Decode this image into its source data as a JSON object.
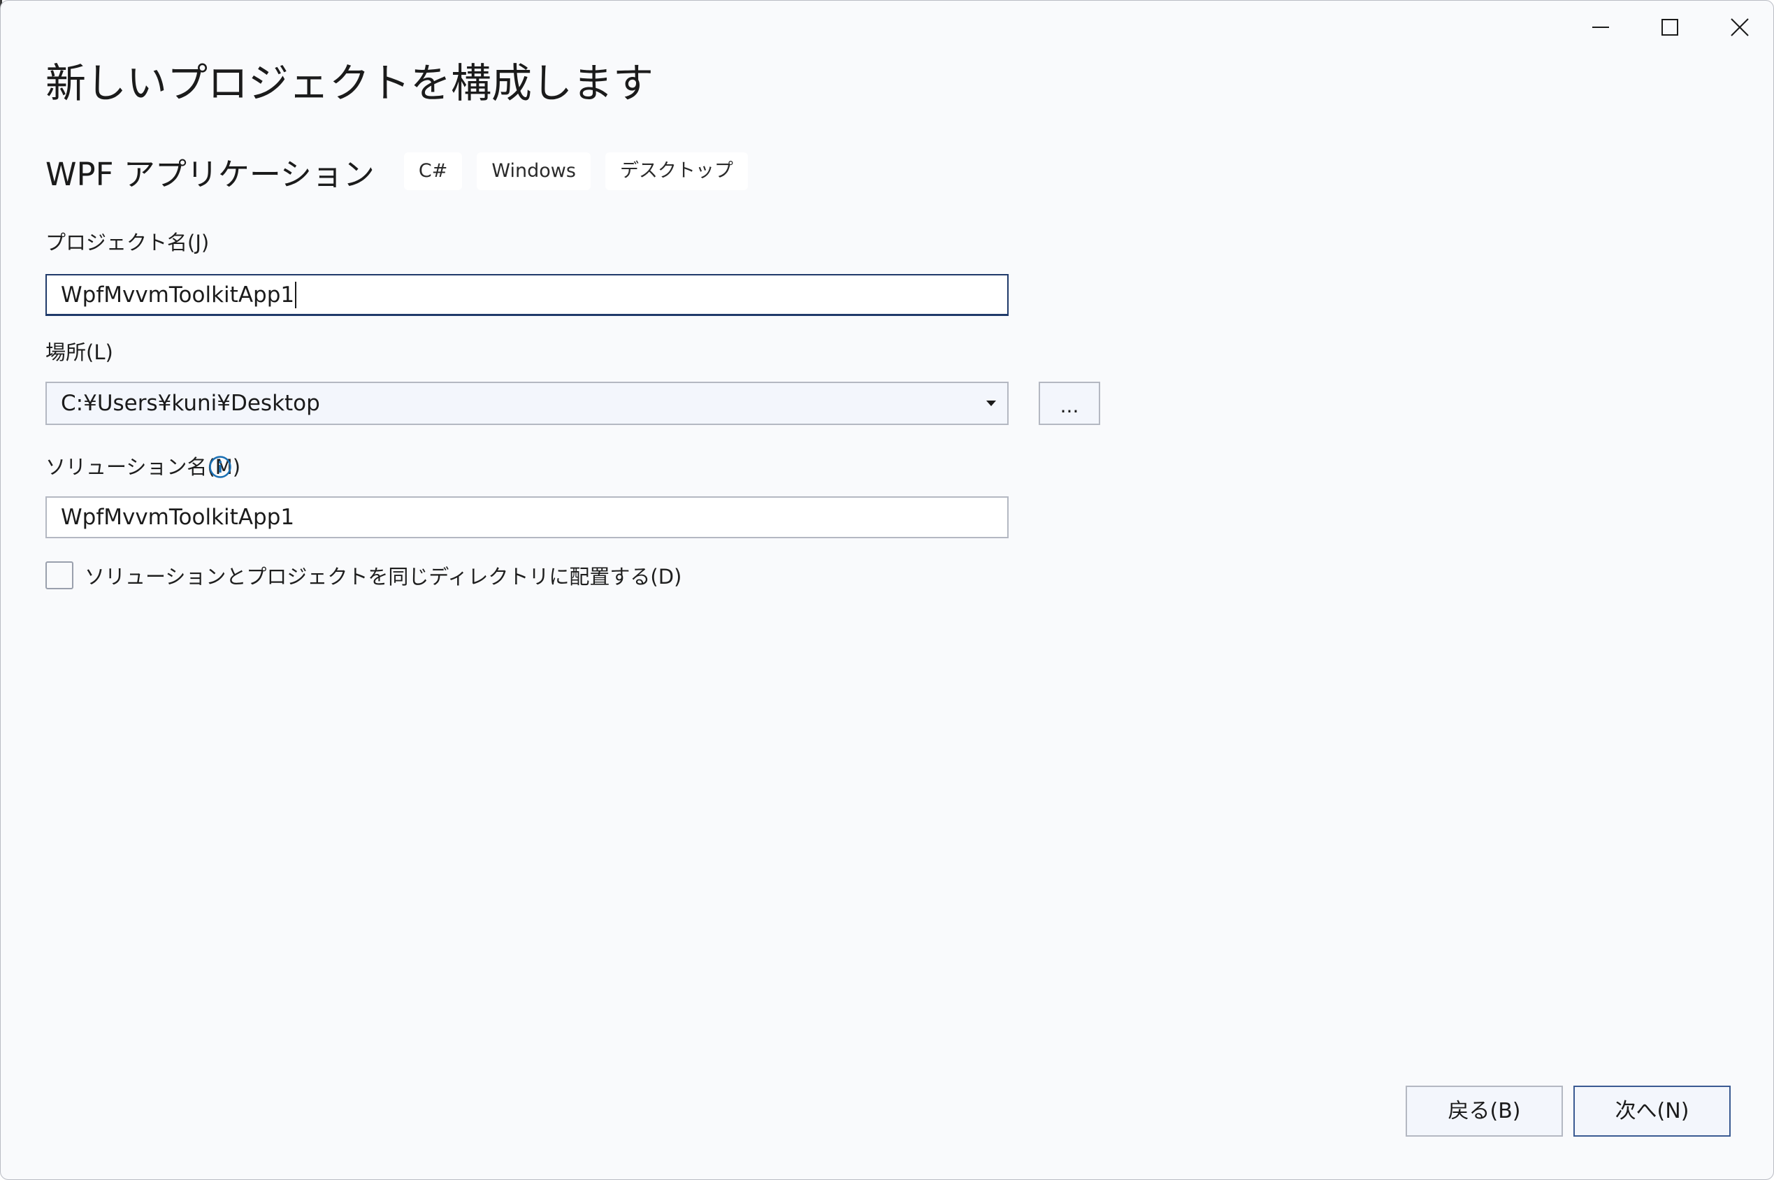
{
  "window": {
    "title": "新しいプロジェクトを構成します",
    "controls": {
      "minimize_icon": "minimize-icon",
      "maximize_icon": "maximize-icon",
      "close_icon": "close-icon"
    }
  },
  "template": {
    "name": "WPF アプリケーション",
    "tags": [
      "C#",
      "Windows",
      "デスクトップ"
    ]
  },
  "project_name": {
    "label": "プロジェクト名(J)",
    "value": "WpfMvvmToolkitApp1"
  },
  "location": {
    "label": "場所(L)",
    "value": "C:¥Users¥kuni¥Desktop",
    "browse_label": "..."
  },
  "solution_name": {
    "label": "ソリューション名(M)",
    "info_icon": "info-icon",
    "value": "WpfMvvmToolkitApp1"
  },
  "same_directory": {
    "label": "ソリューションとプロジェクトを同じディレクトリに配置する(D)",
    "checked": false
  },
  "footer": {
    "back_label": "戻る(B)",
    "next_label": "次へ(N)"
  },
  "colors": {
    "background": "#f9fafc",
    "accent": "#1f3a6a",
    "info": "#1a6fb3"
  }
}
